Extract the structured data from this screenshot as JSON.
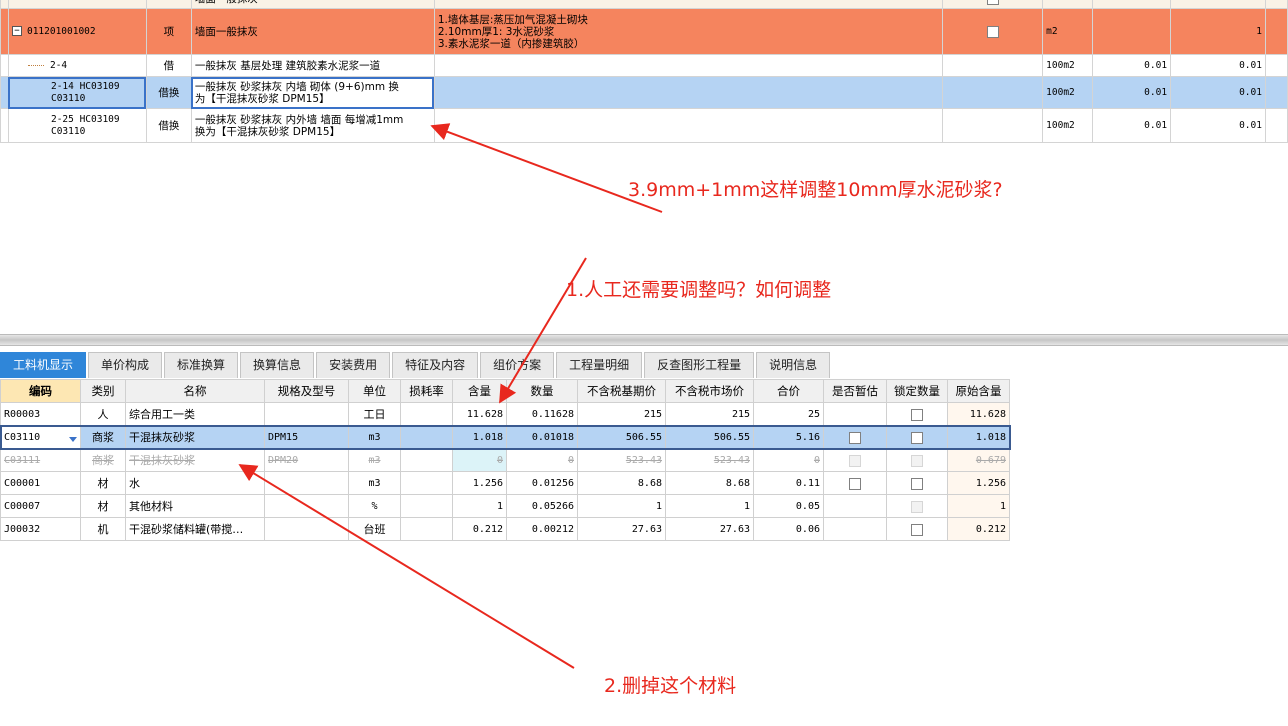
{
  "top_grid": {
    "partial_row": {
      "name": "墙面一般抹灰"
    },
    "rows": [
      {
        "code": "011201001002",
        "type": "项",
        "name": "墙面一般抹灰",
        "feature_lines": [
          "1.墙体基层:蒸压加气混凝土砌块",
          "2.10mm厚1: 3水泥砂浆",
          "3.素水泥浆一道（内掺建筑胶）"
        ],
        "unit": "m2",
        "qty": "",
        "total": "1"
      },
      {
        "code": "2-4",
        "type": "借",
        "name": "一般抹灰 基层处理 建筑胶素水泥浆一道",
        "unit": "100m2",
        "qty": "0.01",
        "total": "0.01"
      },
      {
        "code_lines": [
          "2-14 HC03109",
          "C03110"
        ],
        "type": "借换",
        "name_lines": [
          "一般抹灰 砂浆抹灰 内墙 砌体 (9+6)mm  换",
          "为【干混抹灰砂浆 DPM15】"
        ],
        "unit": "100m2",
        "qty": "0.01",
        "total": "0.01"
      },
      {
        "code_lines": [
          "2-25 HC03109",
          "C03110"
        ],
        "type": "借换",
        "name_lines": [
          "一般抹灰 砂浆抹灰 内外墙 墙面 每增减1mm",
          " 换为【干混抹灰砂浆 DPM15】"
        ],
        "unit": "100m2",
        "qty": "0.01",
        "total": "0.01"
      }
    ]
  },
  "tabs": [
    {
      "label": "工料机显示",
      "active": true
    },
    {
      "label": "单价构成"
    },
    {
      "label": "标准换算"
    },
    {
      "label": "换算信息"
    },
    {
      "label": "安装费用"
    },
    {
      "label": "特征及内容"
    },
    {
      "label": "组价方案"
    },
    {
      "label": "工程量明细"
    },
    {
      "label": "反查图形工程量"
    },
    {
      "label": "说明信息"
    }
  ],
  "bottom_grid": {
    "headers": [
      "编码",
      "类别",
      "名称",
      "规格及型号",
      "单位",
      "损耗率",
      "含量",
      "数量",
      "不含税基期价",
      "不含税市场价",
      "合价",
      "是否暂估",
      "锁定数量",
      "原始含量"
    ],
    "rows": [
      {
        "code": "R00003",
        "cat": "人",
        "name": "综合用工一类",
        "spec": "",
        "unit": "工日",
        "loss": "",
        "content": "11.628",
        "qty": "0.11628",
        "base_price": "215",
        "market_price": "215",
        "total": "25",
        "estimate": "none",
        "lock": "on",
        "orig": "11.628"
      },
      {
        "code": "C03110",
        "cat": "商浆",
        "name": "干混抹灰砂浆",
        "spec": "DPM15",
        "unit": "m3",
        "loss": "",
        "content": "1.018",
        "qty": "0.01018",
        "base_price": "506.55",
        "market_price": "506.55",
        "total": "5.16",
        "estimate": "on",
        "lock": "on",
        "orig": "1.018"
      },
      {
        "code": "C03111",
        "cat": "商浆",
        "name": "干混抹灰砂浆",
        "spec": "DPM20",
        "unit": "m3",
        "loss": "",
        "content": "0",
        "qty": "0",
        "base_price": "523.43",
        "market_price": "523.43",
        "total": "0",
        "estimate": "disabled",
        "lock": "disabled",
        "orig": "0.679"
      },
      {
        "code": "C00001",
        "cat": "材",
        "name": "水",
        "spec": "",
        "unit": "m3",
        "loss": "",
        "content": "1.256",
        "qty": "0.01256",
        "base_price": "8.68",
        "market_price": "8.68",
        "total": "0.11",
        "estimate": "on",
        "lock": "on",
        "orig": "1.256"
      },
      {
        "code": "C00007",
        "cat": "材",
        "name": "其他材料",
        "spec": "",
        "unit": "%",
        "loss": "",
        "content": "1",
        "qty": "0.05266",
        "base_price": "1",
        "market_price": "1",
        "total": "0.05",
        "estimate": "none",
        "lock": "disabled",
        "orig": "1"
      },
      {
        "code": "J00032",
        "cat": "机",
        "name": "干混砂浆储料罐(带搅…",
        "spec": "",
        "unit": "台班",
        "loss": "",
        "content": "0.212",
        "qty": "0.00212",
        "base_price": "27.63",
        "market_price": "27.63",
        "total": "0.06",
        "estimate": "none",
        "lock": "on",
        "orig": "0.212"
      }
    ]
  },
  "annotations": {
    "note1": "3.9mm+1mm这样调整10mm厚水泥砂浆?",
    "note2": "1.人工还需要调整吗？如何调整",
    "note3": "2.删掉这个材料",
    "color": "#e8281e"
  }
}
